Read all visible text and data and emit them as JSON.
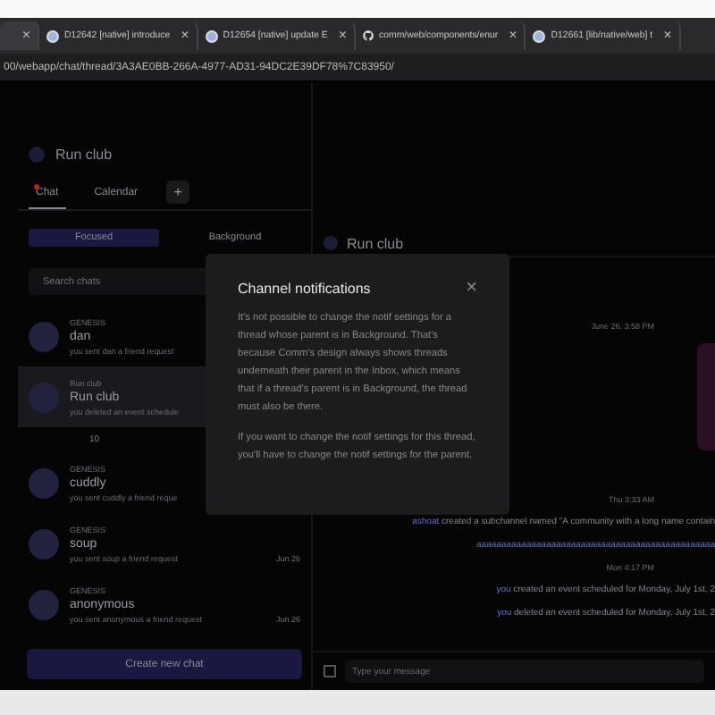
{
  "browser_tabs": [
    {
      "selected": true,
      "close": "×"
    },
    {
      "title": "D12642 [native] introduce",
      "selected": false,
      "kind": "site",
      "close": "×"
    },
    {
      "title": "D12654 [native] update E",
      "selected": false,
      "kind": "site",
      "close": "×"
    },
    {
      "title": "comm/web/components/enur",
      "selected": false,
      "kind": "repo",
      "close": "×"
    },
    {
      "title": "D12661 [lib/native/web] t",
      "selected": false,
      "kind": "site",
      "close": "×"
    }
  ],
  "address_bar": {
    "url": "00/webapp/chat/thread/3A3AE0BB-266A-4977-AD31-94DC2E39DF78%7C83950/"
  },
  "sidebar": {
    "community": "Run club",
    "tabs": [
      {
        "label": "Chat",
        "selected": true,
        "unread": true
      },
      {
        "label": "Calendar",
        "selected": false,
        "unread": false
      }
    ],
    "add_label": "+",
    "filters": [
      {
        "label": "Focused",
        "selected": true
      },
      {
        "label": "Background",
        "selected": false
      }
    ],
    "search": {
      "placeholder": "Search chats"
    },
    "chats": [
      {
        "community": "GENESIS",
        "name": "dan",
        "preview": "you sent dan a friend request",
        "selected": false
      },
      {
        "community": "Run club",
        "name": "Run club",
        "preview": "you deleted an event schedule",
        "selected": true,
        "children": [
          {
            "name": "10"
          }
        ]
      },
      {
        "community": "GENESIS",
        "name": "cuddly",
        "preview": "you sent cuddly a friend reque",
        "selected": false
      },
      {
        "community": "GENESIS",
        "name": "soup",
        "preview": "you sent soup a friend request",
        "time": "Jun 26",
        "selected": false
      },
      {
        "community": "GENESIS",
        "name": "anonymous",
        "preview": "you sent anonymous a friend request",
        "time": "Jun 26",
        "selected": false
      }
    ],
    "create_button": "Create new chat"
  },
  "thread": {
    "title": "Run club",
    "messages": [
      {
        "kind": "time",
        "text": "June 26, 3:58 PM"
      },
      {
        "kind": "image"
      },
      {
        "kind": "time",
        "text": "Thu 3:33 AM"
      },
      {
        "kind": "event",
        "actor": "ashoat",
        "text": "created a subchannel named \"A community with a long name contain"
      },
      {
        "kind": "link",
        "text": "aaaaaaaaaaaaaaaaaaaaaaaaaaaaaaaaaaaaaaaaaaaaaaaa"
      },
      {
        "kind": "time",
        "text": "Mon 4:17 PM"
      },
      {
        "kind": "event",
        "actor": "you",
        "text": "created an event scheduled for Monday, July 1st, 2"
      },
      {
        "kind": "event",
        "actor": "you",
        "text": "deleted an event scheduled for Monday, July 1st, 2"
      }
    ],
    "composer": {
      "placeholder": "Type your message"
    }
  },
  "modal": {
    "title": "Channel notifications",
    "close": "×",
    "paragraphs": [
      "It's not possible to change the notif settings for a thread whose parent is in Background. That's because Comm's design always shows threads underneath their parent in the Inbox, which means that if a thread's parent is in Background, the thread must also be there.",
      "If you want to change the notif settings for this thread, you'll have to change the notif settings for the parent."
    ]
  }
}
